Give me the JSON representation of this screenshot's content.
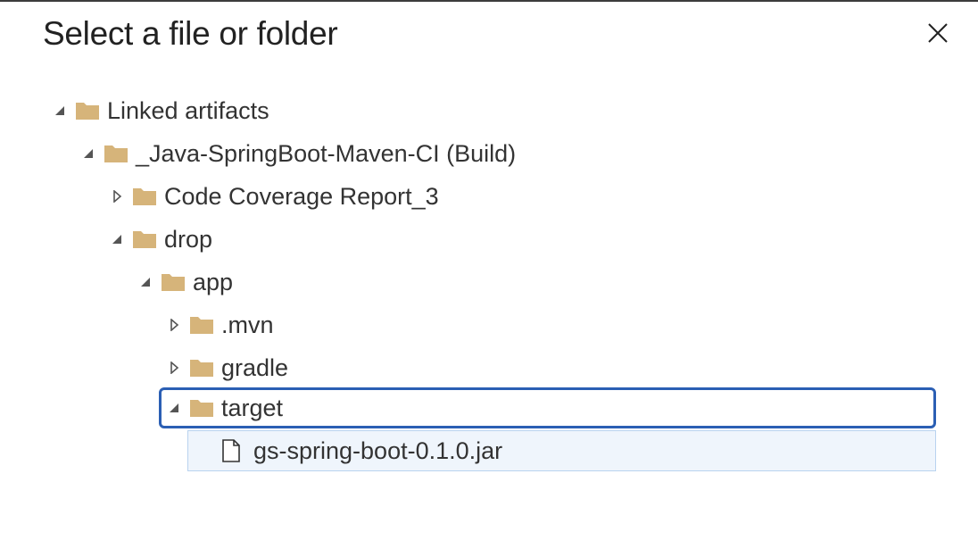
{
  "dialog": {
    "title": "Select a file or folder"
  },
  "colors": {
    "folder": "#d6b47a",
    "focus_border": "#2b5fb4",
    "selected_bg": "#eff5fc",
    "selected_border": "#b9d3ef"
  },
  "tree": {
    "root": {
      "label": "Linked artifacts",
      "expanded": true
    },
    "build": {
      "label": "_Java-SpringBoot-Maven-CI (Build)",
      "expanded": true
    },
    "coverage": {
      "label": "Code Coverage Report_3",
      "expanded": false
    },
    "drop": {
      "label": "drop",
      "expanded": true
    },
    "app": {
      "label": "app",
      "expanded": true
    },
    "mvn": {
      "label": ".mvn",
      "expanded": false
    },
    "gradle": {
      "label": "gradle",
      "expanded": false
    },
    "target": {
      "label": "target",
      "expanded": true,
      "focused": true
    },
    "jar": {
      "label": "gs-spring-boot-0.1.0.jar",
      "selected": true
    }
  }
}
